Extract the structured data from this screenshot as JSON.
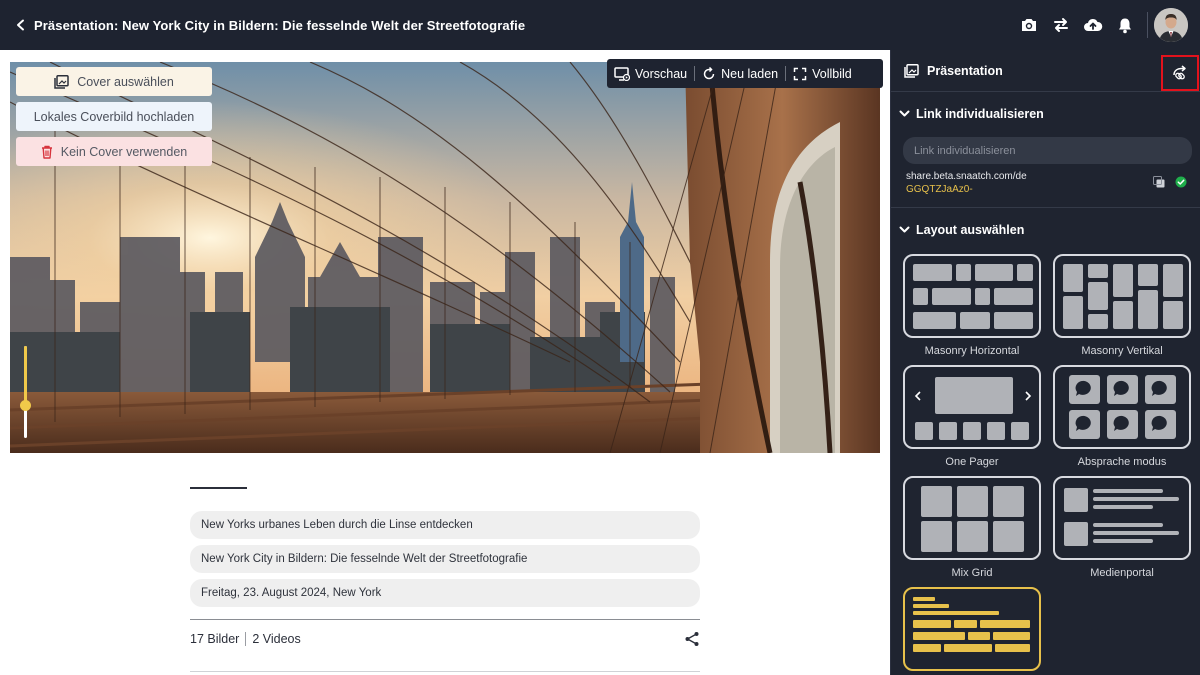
{
  "header": {
    "title": "Präsentation: New York City in Bildern: Die fesselnde Welt der Streetfotografie"
  },
  "cover": {
    "select_label": "Cover auswählen",
    "upload_label": "Lokales Coverbild hochladen",
    "none_label": "Kein Cover verwenden",
    "zoom_level": 0.35
  },
  "toolbar": {
    "preview_label": "Vorschau",
    "reload_label": "Neu laden",
    "fullscreen_label": "Vollbild"
  },
  "presentation": {
    "subtitle": "New Yorks urbanes Leben durch die Linse entdecken",
    "title": "New York City in Bildern: Die fesselnde Welt der Streetfotografie",
    "date_location": "Freitag, 23. August 2024, New York",
    "images_count": "17 Bilder",
    "videos_count": "2 Videos"
  },
  "panel": {
    "title": "Präsentation",
    "link_section": "Link individualisieren",
    "link_placeholder": "Link individualisieren",
    "link_url": "share.beta.snaatch.com/de",
    "link_token": "GGQTZJaAz0-",
    "layout_section": "Layout auswählen",
    "layouts": [
      {
        "label": "Masonry Horizontal"
      },
      {
        "label": "Masonry Vertikal"
      },
      {
        "label": "One Pager"
      },
      {
        "label": "Absprache modus"
      },
      {
        "label": "Mix Grid"
      },
      {
        "label": "Medienportal"
      }
    ]
  },
  "colors": {
    "dark": "#1e2330",
    "accent": "#e7c14b",
    "highlight": "#e3121c"
  }
}
